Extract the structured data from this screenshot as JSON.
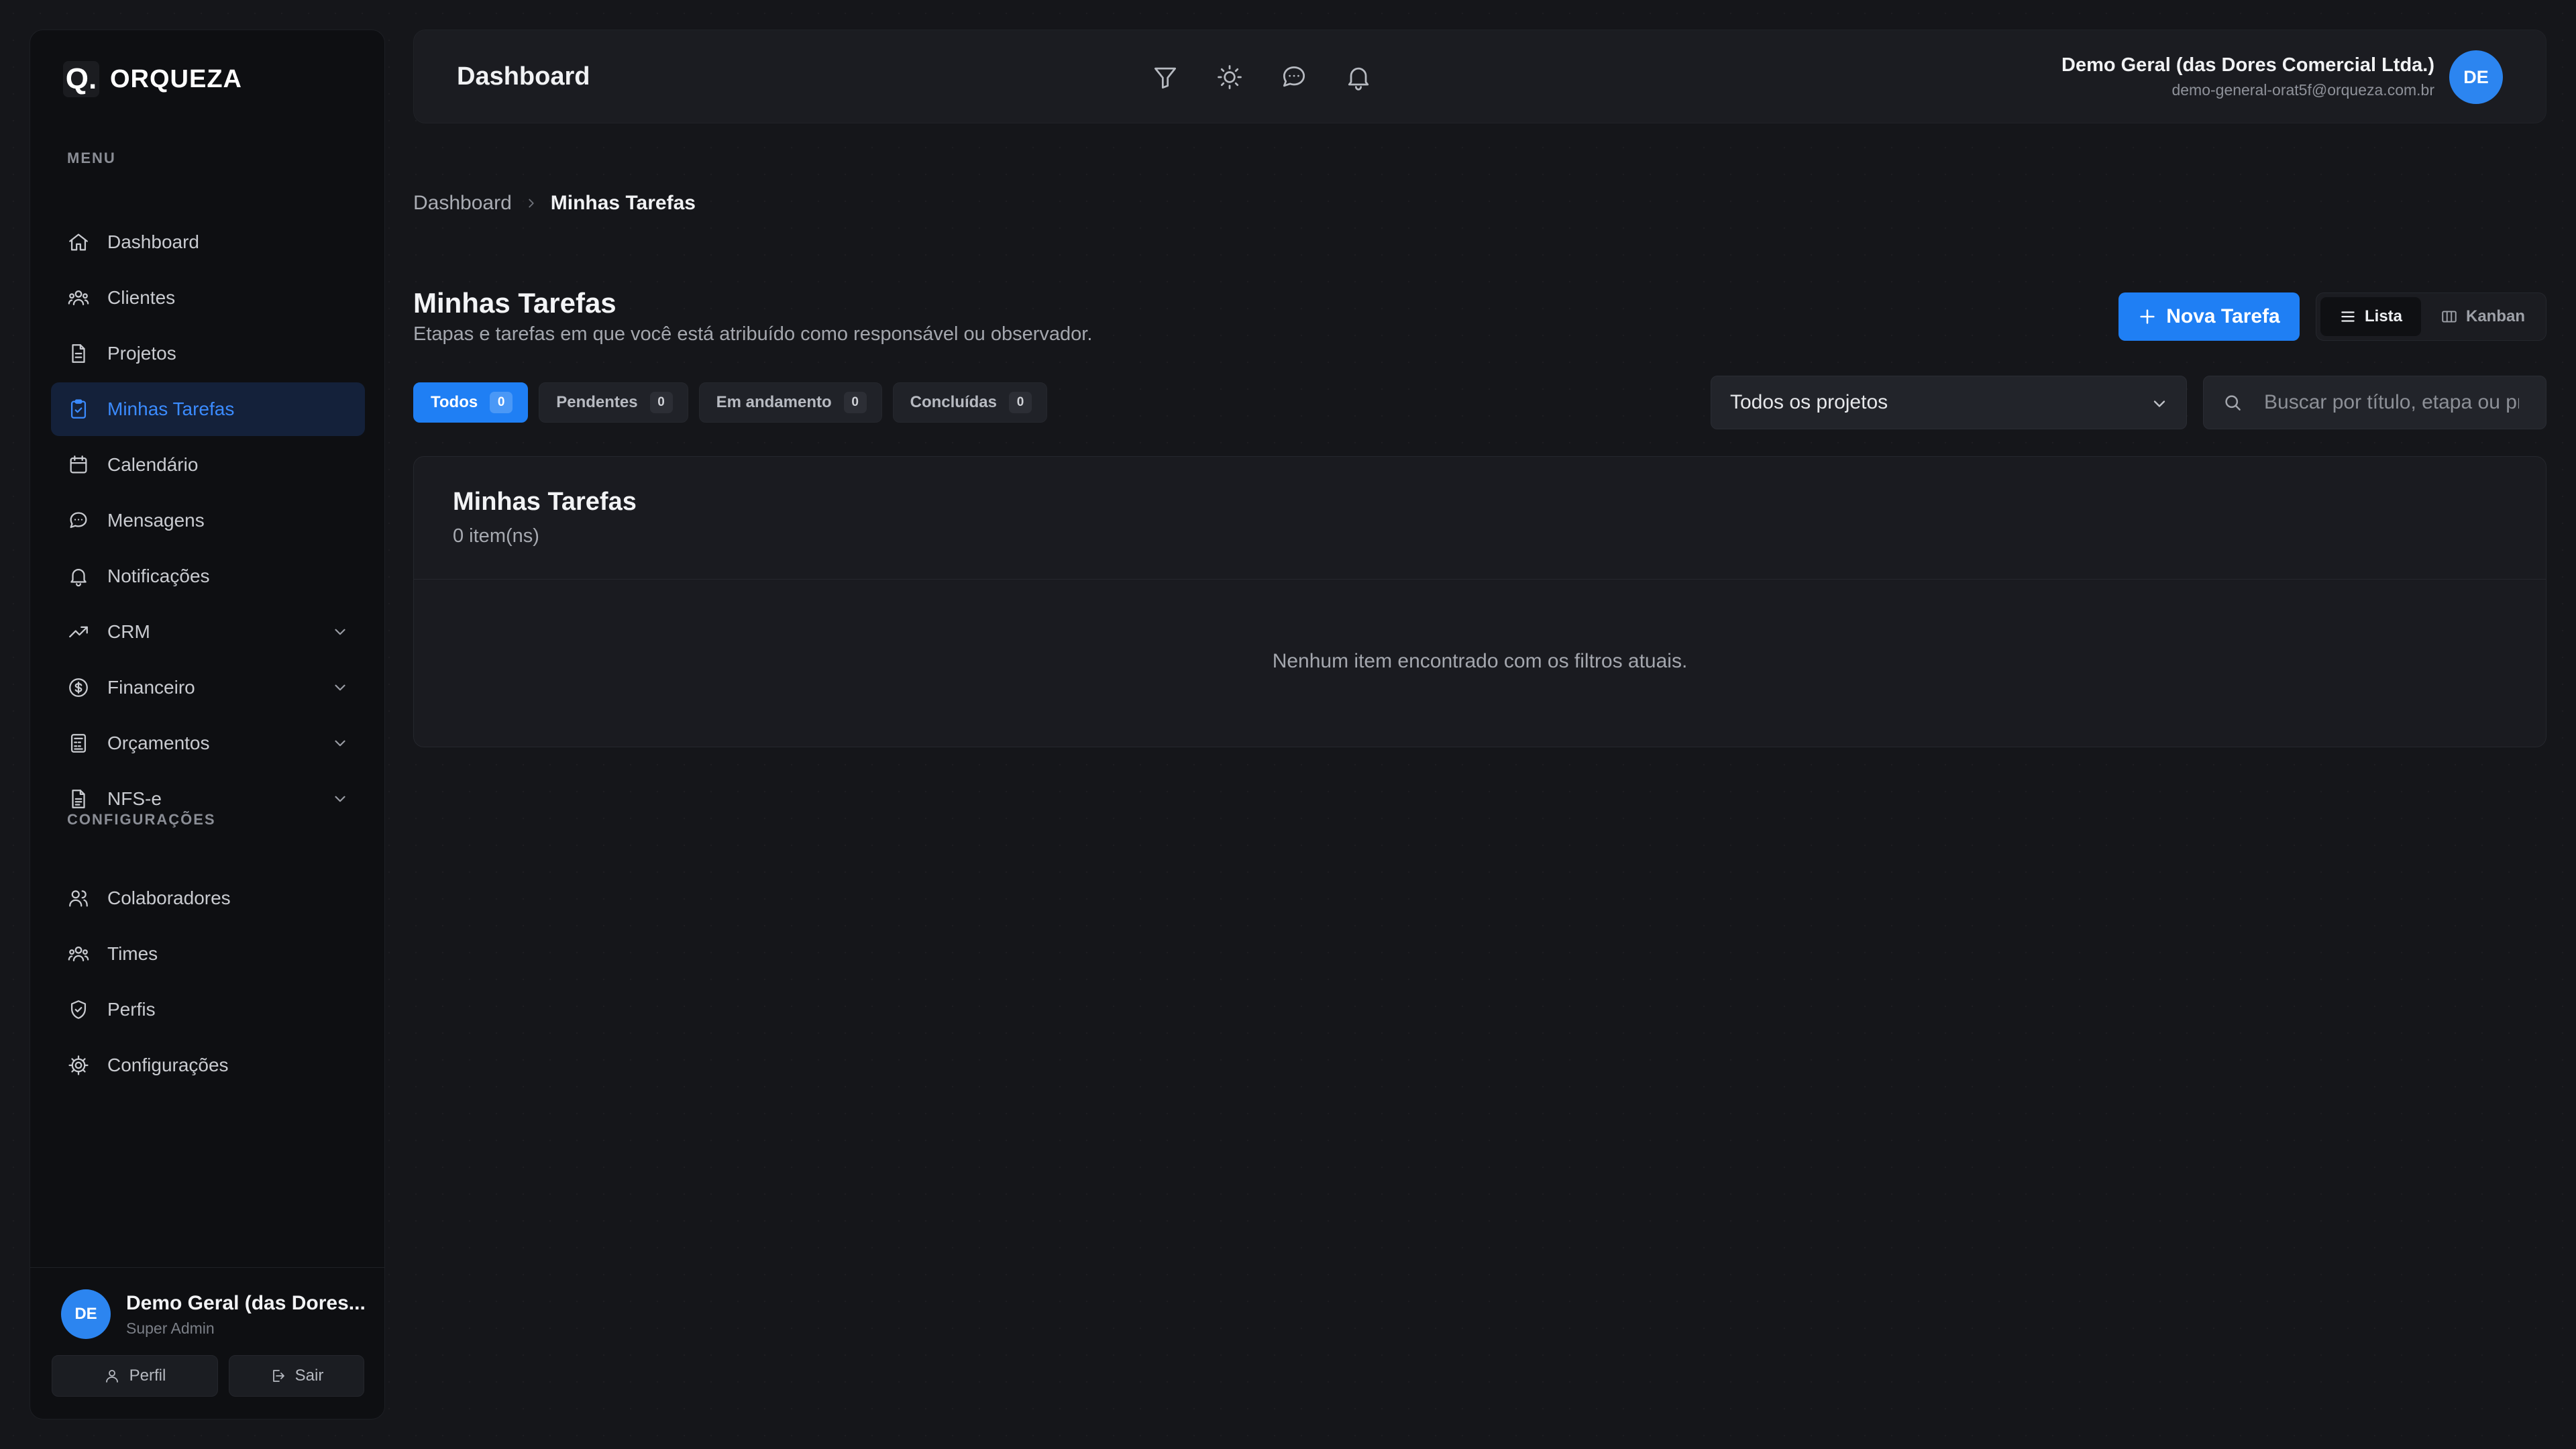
{
  "brand": {
    "logo_mark": "Q.",
    "name": "ORQUEZA"
  },
  "sidebar": {
    "menu_label": "MENU",
    "items": [
      {
        "label": "Dashboard",
        "icon": "home-icon"
      },
      {
        "label": "Clientes",
        "icon": "users-group-icon"
      },
      {
        "label": "Projetos",
        "icon": "document-icon"
      },
      {
        "label": "Minhas Tarefas",
        "icon": "clipboard-check-icon",
        "active": true
      },
      {
        "label": "Calendário",
        "icon": "calendar-icon"
      },
      {
        "label": "Mensagens",
        "icon": "chat-icon"
      },
      {
        "label": "Notificações",
        "icon": "bell-icon"
      },
      {
        "label": "CRM",
        "icon": "trending-up-icon",
        "expandable": true
      },
      {
        "label": "Financeiro",
        "icon": "dollar-circle-icon",
        "expandable": true
      },
      {
        "label": "Orçamentos",
        "icon": "calculator-icon",
        "expandable": true
      },
      {
        "label": "NFS-e",
        "icon": "file-text-icon",
        "expandable": true
      }
    ],
    "config_label": "CONFIGURAÇÕES",
    "config_items": [
      {
        "label": "Colaboradores",
        "icon": "users-icon"
      },
      {
        "label": "Times",
        "icon": "team-icon"
      },
      {
        "label": "Perfis",
        "icon": "shield-icon"
      },
      {
        "label": "Configurações",
        "icon": "gear-icon"
      }
    ],
    "footer": {
      "avatar": "DE",
      "name": "Demo Geral (das Dores...",
      "role": "Super Admin",
      "profile_label": "Perfil",
      "logout_label": "Sair"
    }
  },
  "header": {
    "title": "Dashboard",
    "icons": [
      "filter-icon",
      "sun-icon",
      "chat-icon",
      "bell-icon"
    ],
    "user_name": "Demo Geral (das Dores Comercial Ltda.)",
    "user_email": "demo-general-orat5f@orqueza.com.br",
    "avatar": "DE"
  },
  "breadcrumb": {
    "root": "Dashboard",
    "current": "Minhas Tarefas"
  },
  "page": {
    "title": "Minhas Tarefas",
    "subtitle": "Etapas e tarefas em que você está atribuído como responsável ou observador.",
    "new_task_label": "Nova Tarefa",
    "view_list_label": "Lista",
    "view_kanban_label": "Kanban"
  },
  "filters": {
    "tabs": [
      {
        "label": "Todos",
        "count": "0",
        "active": true
      },
      {
        "label": "Pendentes",
        "count": "0"
      },
      {
        "label": "Em andamento",
        "count": "0"
      },
      {
        "label": "Concluídas",
        "count": "0"
      }
    ],
    "project_select": "Todos os projetos",
    "search_placeholder": "Buscar por título, etapa ou projeto"
  },
  "tasks_card": {
    "title": "Minhas Tarefas",
    "count_text": "0 item(ns)",
    "empty_text": "Nenhum item encontrado com os filtros atuais."
  },
  "colors": {
    "accent": "#1f7ff4",
    "active_bg": "#14213a",
    "background": "#15161a"
  }
}
